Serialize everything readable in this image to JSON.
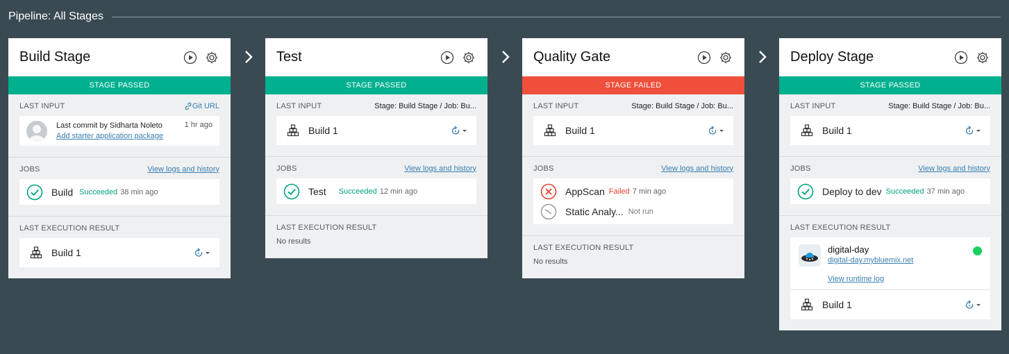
{
  "pipeline": {
    "title": "Pipeline: All Stages"
  },
  "common": {
    "last_input_label": "LAST INPUT",
    "jobs_label": "JOBS",
    "view_logs": "View logs and history",
    "last_exec_label": "LAST EXECUTION RESULT",
    "no_results": "No results"
  },
  "stages": [
    {
      "title": "Build Stage",
      "status": "STAGE PASSED",
      "git_url": "Git URL",
      "commit": {
        "text": "Last commit by Sidharta Noleto",
        "message": "Add starter application package",
        "time": "1 hr ago"
      },
      "jobs": [
        {
          "name": "Build",
          "status": "Succeeded",
          "time": "38 min ago"
        }
      ],
      "result": {
        "build": "Build 1"
      }
    },
    {
      "title": "Test",
      "status": "STAGE PASSED",
      "input_source": "Stage: Build Stage  /  Job: Bu...",
      "input_build": "Build 1",
      "jobs": [
        {
          "name": "Test",
          "status": "Succeeded",
          "time": "12 min ago"
        }
      ]
    },
    {
      "title": "Quality Gate",
      "status": "STAGE FAILED",
      "input_source": "Stage: Build Stage  /  Job: Bu...",
      "input_build": "Build 1",
      "jobs": [
        {
          "name": "AppScan",
          "status": "Failed",
          "time": "7 min ago"
        },
        {
          "name": "Static Analy...",
          "status": "Not run"
        }
      ]
    },
    {
      "title": "Deploy Stage",
      "status": "STAGE PASSED",
      "input_source": "Stage: Build Stage  /  Job: Bu...",
      "input_build": "Build 1",
      "jobs": [
        {
          "name": "Deploy to dev",
          "status": "Succeeded",
          "time": "37 min ago"
        }
      ],
      "result": {
        "app_name": "digital-day",
        "app_url": "digital-day.mybluemix.net",
        "runtime_log": "View runtime log",
        "build": "Build 1"
      }
    }
  ],
  "colors": {
    "passed": "#00b08f",
    "failed": "#ef4f3b",
    "running": "#19d15f",
    "link": "#3a7fb0"
  }
}
